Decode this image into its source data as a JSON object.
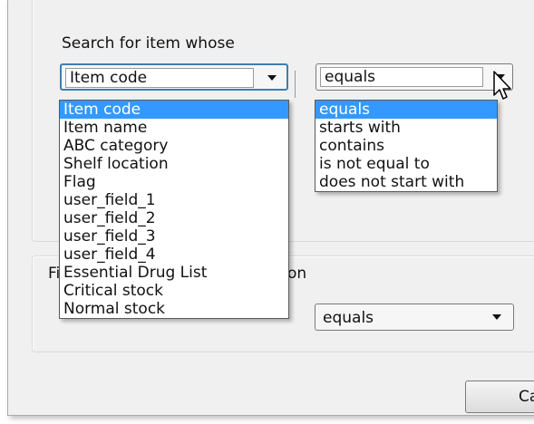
{
  "search": {
    "label": "Search for item whose",
    "field_select": {
      "value": "Item code",
      "options": [
        "Item code",
        "Item name",
        "ABC category",
        "Shelf location",
        "Flag",
        "user_field_1",
        "user_field_2",
        "user_field_3",
        "user_field_4",
        "Essential Drug List",
        "Critical stock",
        "Normal stock"
      ],
      "selected_index": 0
    },
    "operator_select": {
      "value": "equals",
      "options": [
        "equals",
        "starts with",
        "contains",
        "is not equal to",
        "does not start with"
      ],
      "selected_index": 0
    }
  },
  "filter": {
    "label_left": "Fi",
    "label_right": "on",
    "operator_select": {
      "value": "equals"
    }
  },
  "buttons": {
    "cancel_label": "Ca"
  },
  "colors": {
    "selection": "#3399ff",
    "dialog_bg": "#f0f0f0",
    "focus_border": "#3c7fb1"
  }
}
